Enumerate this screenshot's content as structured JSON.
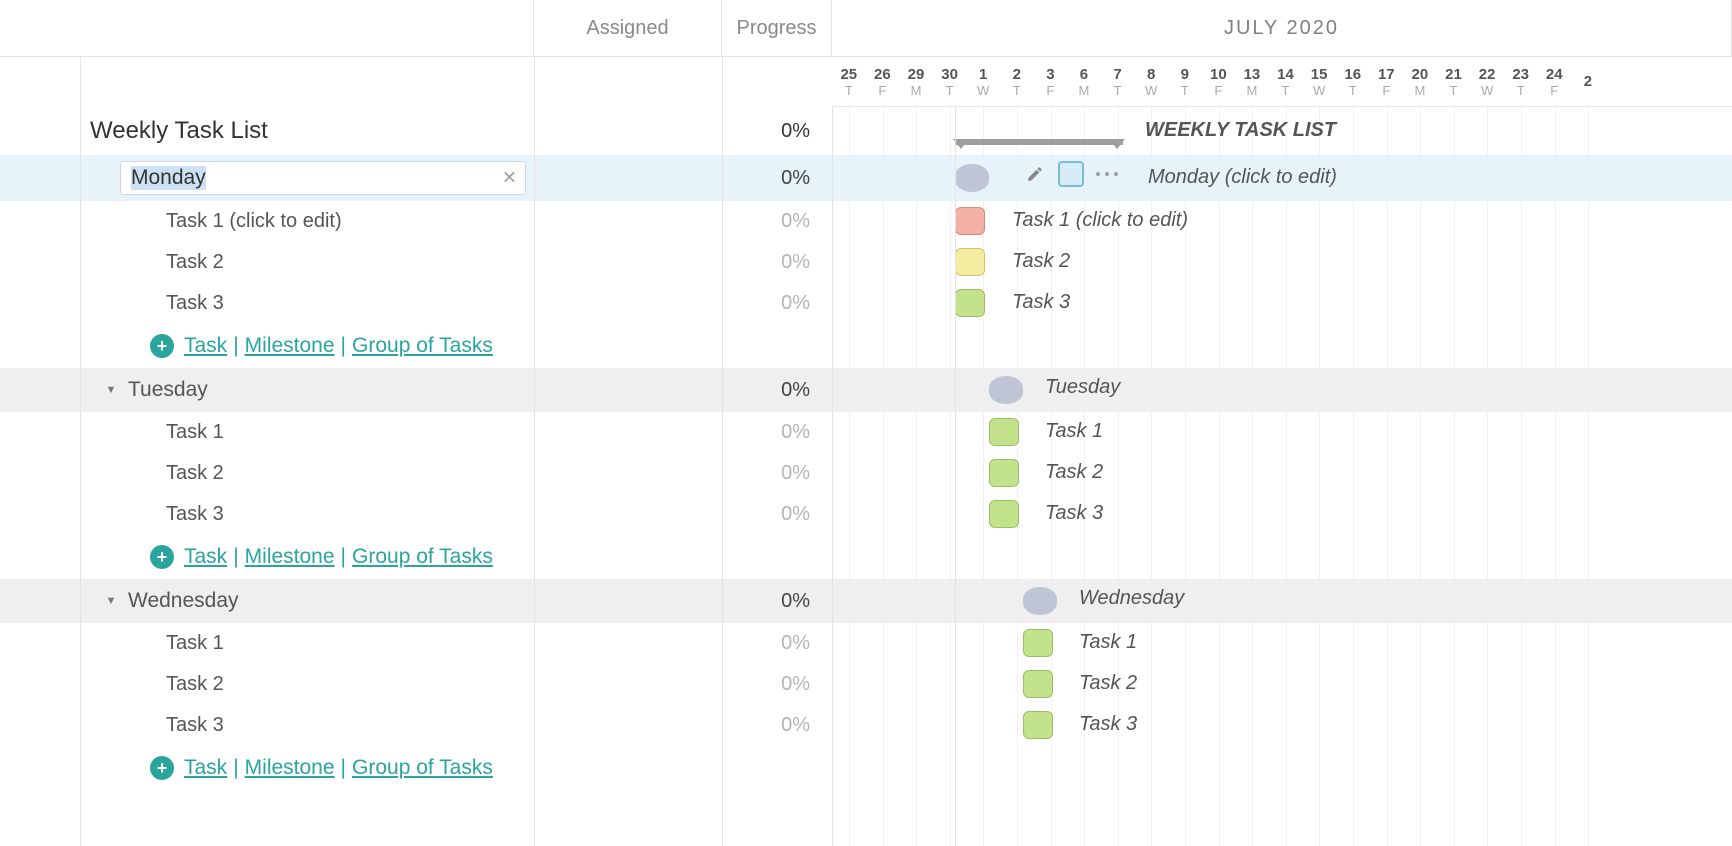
{
  "columns": {
    "assigned": "Assigned",
    "progress": "Progress"
  },
  "timeline": {
    "month_label": "JULY 2020",
    "summary_label": "WEEKLY TASK LIST",
    "days": [
      {
        "num": "25",
        "dow": "T"
      },
      {
        "num": "26",
        "dow": "F"
      },
      {
        "num": "29",
        "dow": "M"
      },
      {
        "num": "30",
        "dow": "T"
      },
      {
        "num": "1",
        "dow": "W"
      },
      {
        "num": "2",
        "dow": "T"
      },
      {
        "num": "3",
        "dow": "F"
      },
      {
        "num": "6",
        "dow": "M"
      },
      {
        "num": "7",
        "dow": "T"
      },
      {
        "num": "8",
        "dow": "W"
      },
      {
        "num": "9",
        "dow": "T"
      },
      {
        "num": "10",
        "dow": "F"
      },
      {
        "num": "13",
        "dow": "M"
      },
      {
        "num": "14",
        "dow": "T"
      },
      {
        "num": "15",
        "dow": "W"
      },
      {
        "num": "16",
        "dow": "T"
      },
      {
        "num": "17",
        "dow": "F"
      },
      {
        "num": "20",
        "dow": "M"
      },
      {
        "num": "21",
        "dow": "T"
      },
      {
        "num": "22",
        "dow": "W"
      },
      {
        "num": "23",
        "dow": "T"
      },
      {
        "num": "24",
        "dow": "F"
      },
      {
        "num": "2",
        "dow": ""
      }
    ]
  },
  "project": {
    "title": "Weekly Task List",
    "progress": "0%"
  },
  "active_edit": {
    "day": "Monday",
    "progress": "0%",
    "gantt_label": "Monday (click to edit)"
  },
  "add_links": {
    "task": "Task",
    "milestone": "Milestone",
    "group": "Group of Tasks"
  },
  "groups": [
    {
      "name": "Monday",
      "progress": "0%",
      "tasks": [
        {
          "name": "Task 1 (click to edit)",
          "progress": "0%",
          "color": "red",
          "gantt_label": "Task 1 (click to edit)"
        },
        {
          "name": "Task 2",
          "progress": "0%",
          "color": "yellow",
          "gantt_label": "Task 2"
        },
        {
          "name": "Task 3",
          "progress": "0%",
          "color": "green",
          "gantt_label": "Task 3"
        }
      ]
    },
    {
      "name": "Tuesday",
      "progress": "0%",
      "gantt_label": "Tuesday",
      "tasks": [
        {
          "name": "Task 1",
          "progress": "0%",
          "color": "green",
          "gantt_label": "Task 1"
        },
        {
          "name": "Task 2",
          "progress": "0%",
          "color": "green",
          "gantt_label": "Task 2"
        },
        {
          "name": "Task 3",
          "progress": "0%",
          "color": "green",
          "gantt_label": "Task 3"
        }
      ]
    },
    {
      "name": "Wednesday",
      "progress": "0%",
      "gantt_label": "Wednesday",
      "tasks": [
        {
          "name": "Task 1",
          "progress": "0%",
          "color": "green",
          "gantt_label": "Task 1"
        },
        {
          "name": "Task 2",
          "progress": "0%",
          "color": "green",
          "gantt_label": "Task 2"
        },
        {
          "name": "Task 3",
          "progress": "0%",
          "color": "green",
          "gantt_label": "Task 3"
        }
      ]
    }
  ]
}
